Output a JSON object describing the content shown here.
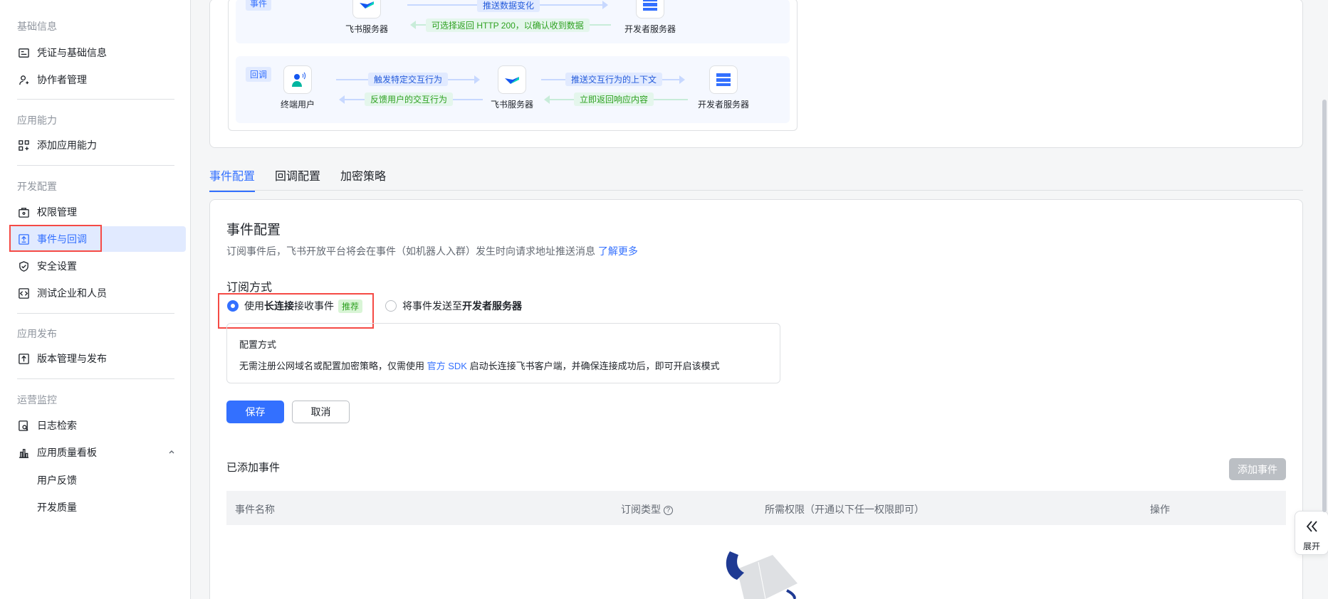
{
  "sidebar": {
    "groups": {
      "basic": "基础信息",
      "capability": "应用能力",
      "dev": "开发配置",
      "release": "应用发布",
      "ops": "运营监控"
    },
    "items": {
      "credentials": "凭证与基础信息",
      "collaborators": "协作者管理",
      "add_capability": "添加应用能力",
      "permissions": "权限管理",
      "events": "事件与回调",
      "security": "安全设置",
      "test_enterprise": "测试企业和人员",
      "version": "版本管理与发布",
      "logs": "日志检索",
      "quality": "应用质量看板",
      "feedback": "用户反馈",
      "dev_quality": "开发质量"
    }
  },
  "flow": {
    "event_tag": "事件",
    "callback_tag": "回调",
    "top_labels": {
      "push_change": "推送数据变化",
      "return_200": "可选择返回 HTTP 200，以确认收到数据"
    },
    "top_nodes": {
      "feishu": "飞书服务器",
      "dev": "开发者服务器"
    },
    "callback_nodes": {
      "user": "终端用户",
      "feishu": "飞书服务器",
      "dev": "开发者服务器"
    },
    "callback_labels": {
      "trigger": "触发特定交互行为",
      "feedback": "反馈用户的交互行为",
      "push_ctx": "推送交互行为的上下文",
      "respond": "立即返回响应内容"
    }
  },
  "tabs": [
    "事件配置",
    "回调配置",
    "加密策略"
  ],
  "event_config": {
    "title": "事件配置",
    "desc": "订阅事件后，飞书开放平台将会在事件（如机器人入群）发生时向请求地址推送消息 ",
    "learn_more": "了解更多",
    "mode_title": "订阅方式",
    "option1_prefix": "使用 ",
    "option1_bold": "长连接",
    "option1_suffix": " 接收事件",
    "recommend": "推荐",
    "option2_prefix": "将事件发送至 ",
    "option2_bold": "开发者服务器",
    "config_title": "配置方式",
    "config_desc_prefix": "无需注册公网域名或配置加密策略，仅需使用 ",
    "config_sdk": "官方 SDK",
    "config_desc_suffix": " 启动长连接飞书客户端，并确保连接成功后，即可开启该模式",
    "save": "保存",
    "cancel": "取消"
  },
  "added_events": {
    "title": "已添加事件",
    "add_button": "添加事件",
    "columns": [
      "事件名称",
      "订阅类型",
      "所需权限（开通以下任一权限即可）",
      "操作"
    ]
  },
  "expand_label": "展开",
  "colors": {
    "primary": "#3370ff",
    "active_bg": "#e1eaff",
    "highlight": "#f54a45"
  }
}
